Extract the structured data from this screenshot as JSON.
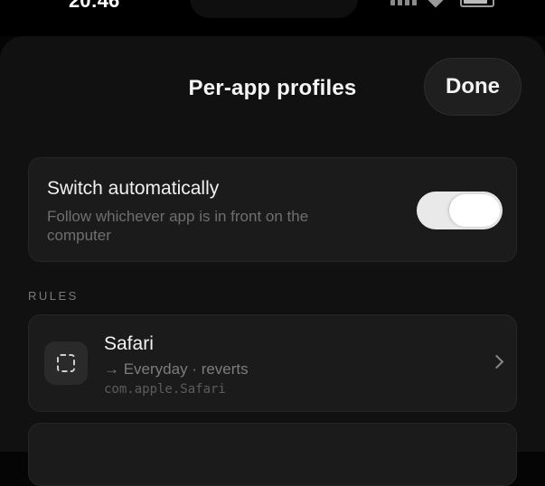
{
  "status": {
    "time": "20:46"
  },
  "header": {
    "title": "Per-app profiles",
    "done_label": "Done"
  },
  "auto_switch": {
    "title": "Switch automatically",
    "subtitle": "Follow whichever app is in front on the computer",
    "enabled": true
  },
  "rules": {
    "section_label": "RULES",
    "items": [
      {
        "name": "Safari",
        "detail": "→ Everyday · reverts",
        "bundle_id": "com.apple.Safari",
        "icon": "app-placeholder-icon"
      }
    ]
  }
}
